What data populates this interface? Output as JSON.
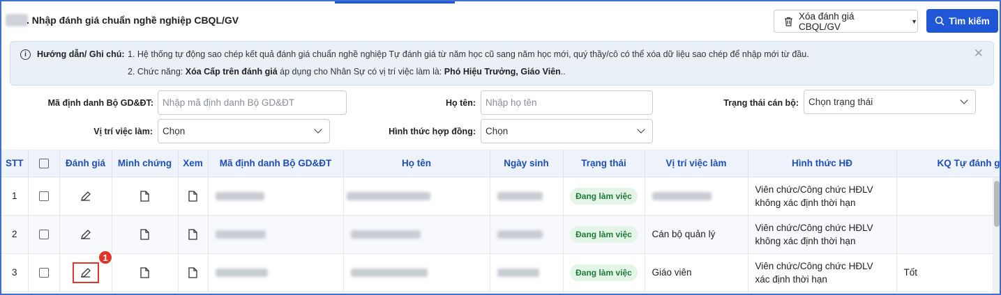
{
  "header": {
    "title": ". Nhập đánh giá chuẩn nghề nghiệp CBQL/GV",
    "delete_button": "Xóa đánh giá CBQL/GV",
    "search_button": "Tìm kiếm"
  },
  "notice": {
    "label": "Hướng dẫn/ Ghi chú:",
    "line1": "1. Hệ thống tự động sao chép kết quả đánh giá chuẩn nghề nghiệp Tự đánh giá từ năm học cũ sang năm học mới, quý thầy/cô có thể xóa dữ liệu sao chép để nhập mới từ đầu.",
    "line2_prefix": "2. Chức năng: ",
    "line2_bold1": "Xóa Cấp trên đánh giá",
    "line2_mid": " áp dụng cho Nhân Sự có vị trí việc làm là: ",
    "line2_bold2": "Phó Hiệu Trưởng, Giáo Viên",
    "line2_suffix": ".."
  },
  "filters": {
    "ma_dinh_danh_label": "Mã định danh Bộ GD&ĐT:",
    "ma_dinh_danh_placeholder": "Nhập mã định danh Bộ GD&ĐT",
    "ho_ten_label": "Họ tên:",
    "ho_ten_placeholder": "Nhập họ tên",
    "trang_thai_label": "Trạng thái cán bộ:",
    "trang_thai_value": "Chọn trạng thái",
    "vi_tri_label": "Vị trí việc làm:",
    "vi_tri_value": "Chọn",
    "hinh_thuc_label": "Hình thức hợp đồng:",
    "hinh_thuc_value": "Chọn"
  },
  "table": {
    "headers": {
      "stt": "STT",
      "danh_gia": "Đánh giá",
      "minh_chung": "Minh chứng",
      "xem": "Xem",
      "ma_dinh_danh": "Mã định danh Bộ GD&ĐT",
      "ho_ten": "Họ tên",
      "ngay_sinh": "Ngày sinh",
      "trang_thai": "Trạng thái",
      "vi_tri": "Vị trí việc làm",
      "hinh_thuc": "Hình thức HĐ",
      "kq": "KQ Tự đánh g"
    },
    "rows": [
      {
        "stt": "1",
        "trang_thai": "Đang làm việc",
        "vi_tri": "",
        "hinh_thuc_1": "Viên chức/Công chức HĐLV",
        "hinh_thuc_2": "không xác định thời hạn",
        "kq": ""
      },
      {
        "stt": "2",
        "trang_thai": "Đang làm việc",
        "vi_tri": "Cán bộ quản lý",
        "hinh_thuc_1": "Viên chức/Công chức HĐLV",
        "hinh_thuc_2": "không xác định thời hạn",
        "kq": ""
      },
      {
        "stt": "3",
        "trang_thai": "Đang làm việc",
        "vi_tri": "Giáo viên",
        "hinh_thuc_1": "Viên chức/Công chức HĐLV",
        "hinh_thuc_2": "xác định thời hạn",
        "kq": "Tốt"
      }
    ],
    "callout_number": "1"
  },
  "colors": {
    "primary": "#1f57d6",
    "header_text": "#1e4fb8",
    "badge_bg": "#e3f5e7",
    "badge_text": "#1f7a3a",
    "highlight": "#e0352b"
  }
}
